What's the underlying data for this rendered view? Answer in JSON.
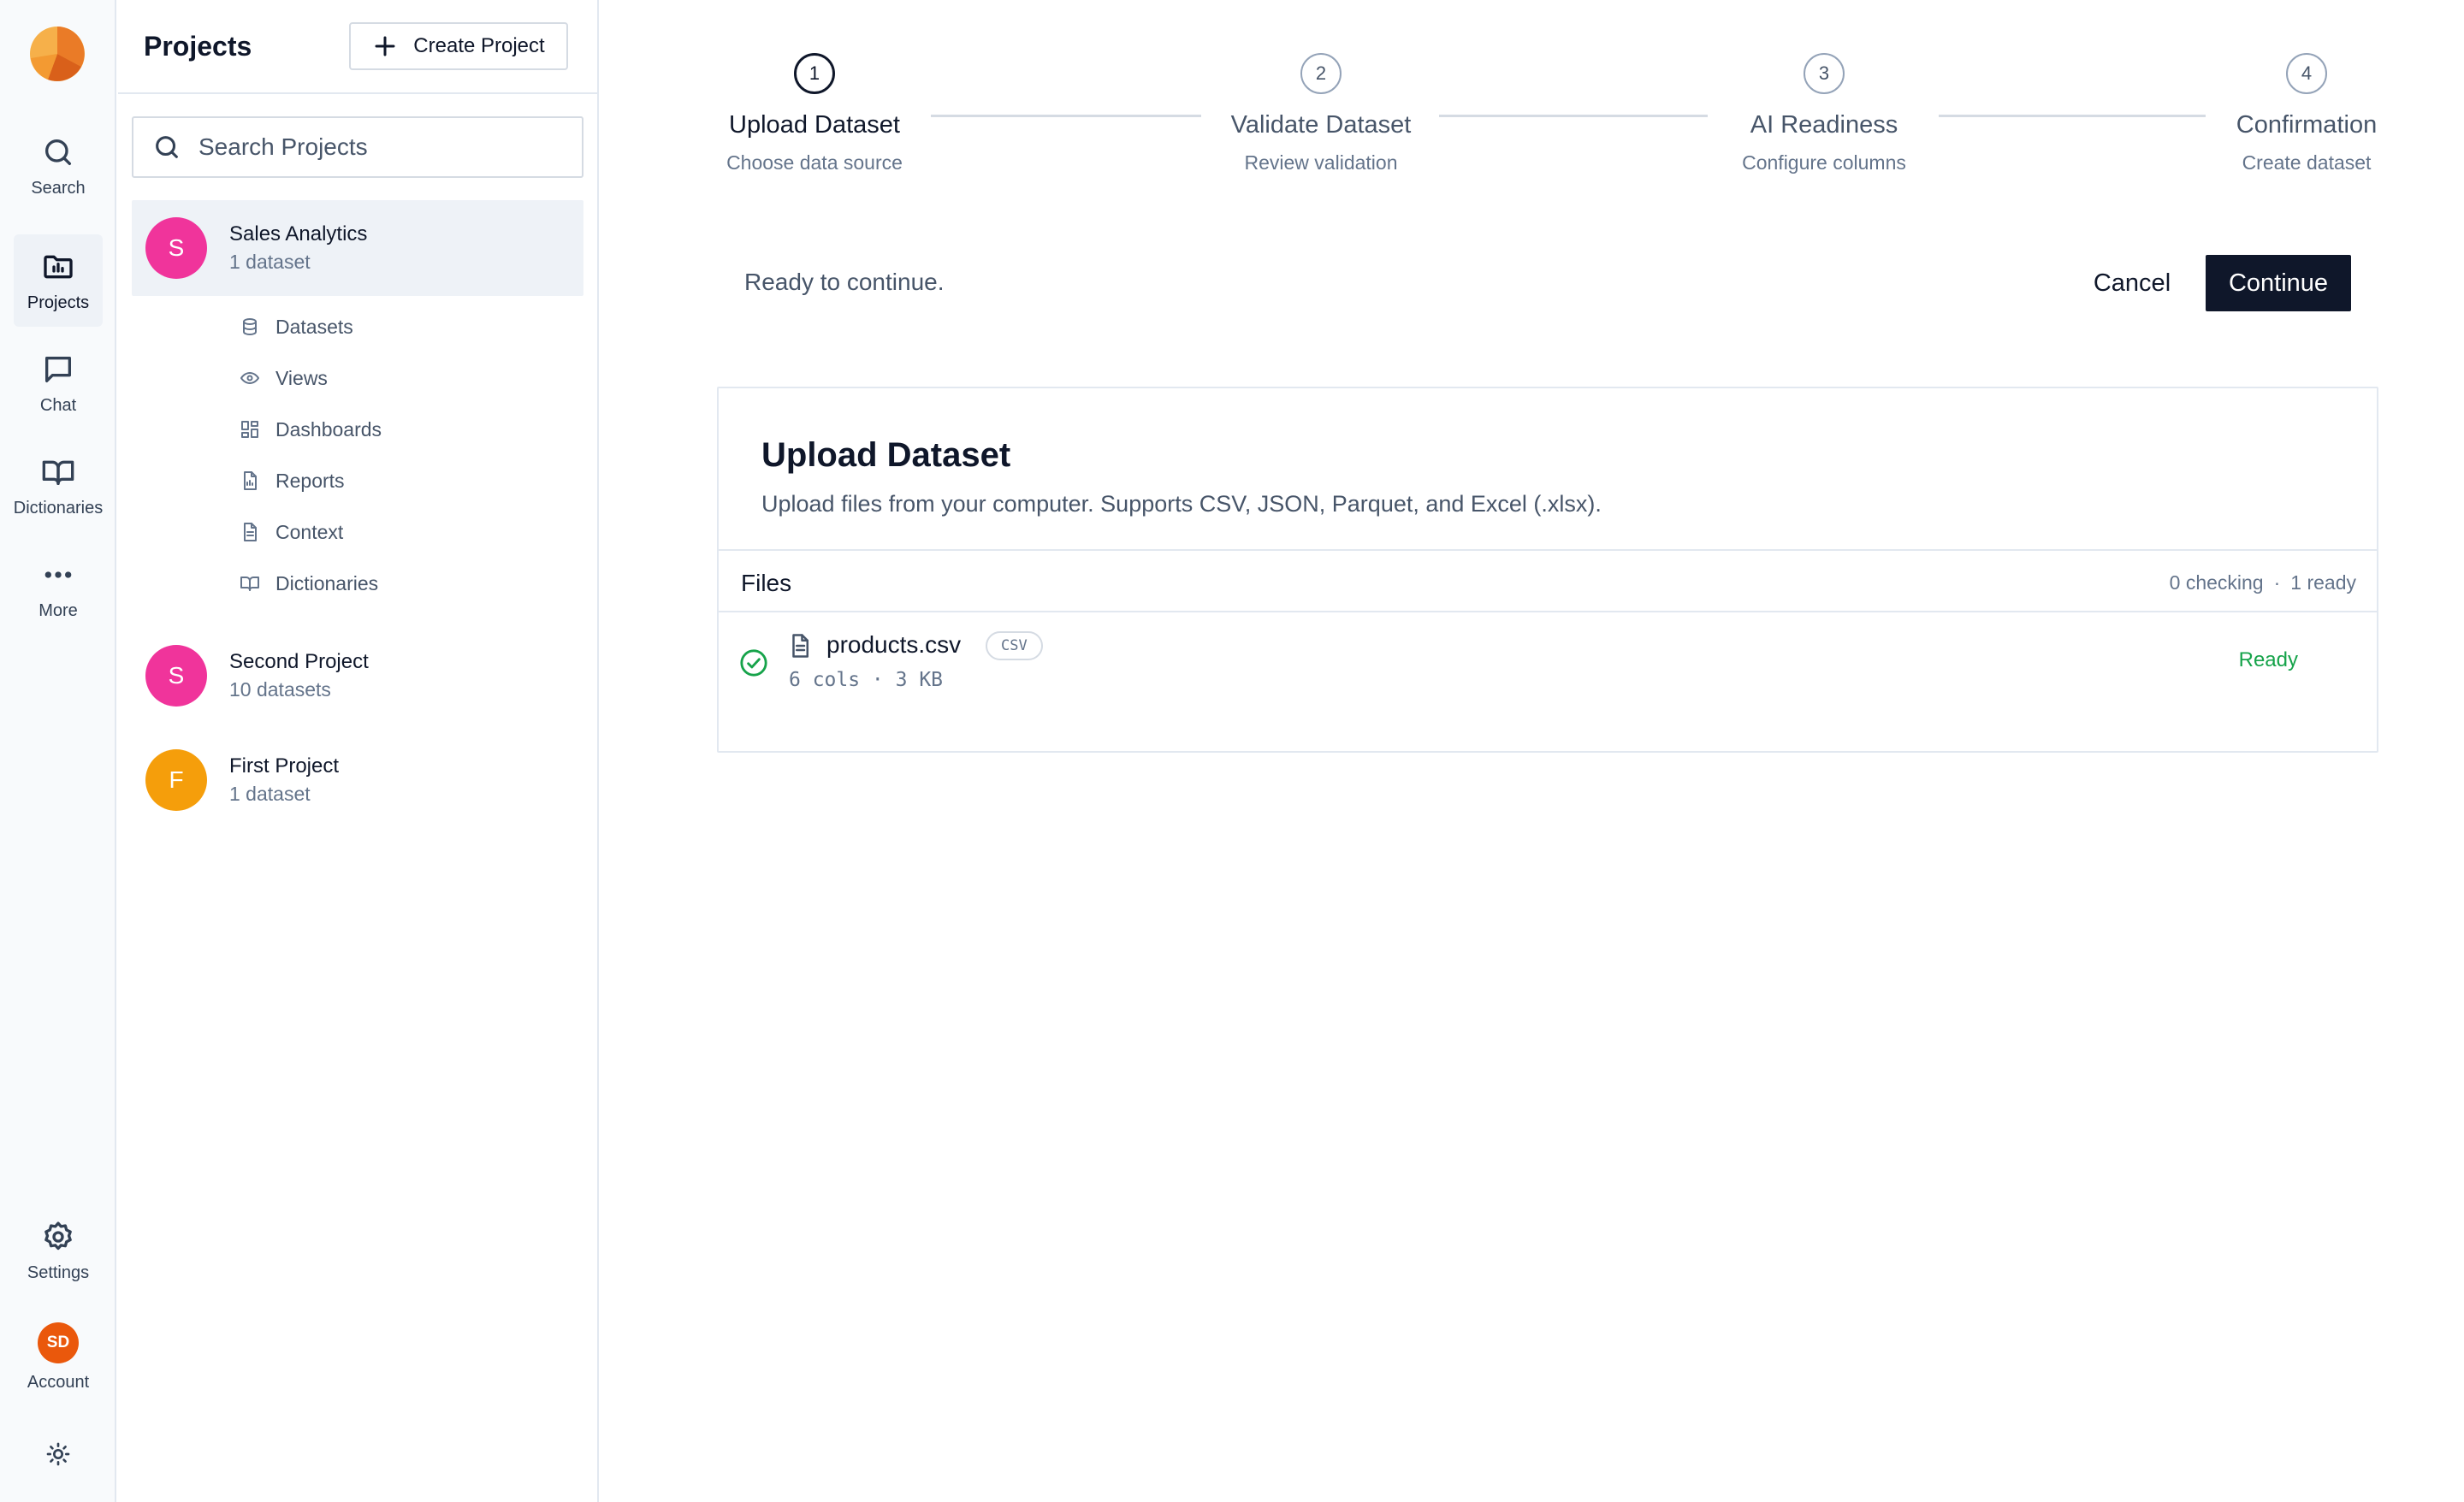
{
  "rail": {
    "items": [
      {
        "label": "Search",
        "icon": "search-icon"
      },
      {
        "label": "Projects",
        "icon": "folder-icon"
      },
      {
        "label": "Chat",
        "icon": "chat-icon"
      },
      {
        "label": "Dictionaries",
        "icon": "book-icon"
      },
      {
        "label": "More",
        "icon": "more-icon"
      }
    ],
    "settings_label": "Settings",
    "account_initials": "SD",
    "account_label": "Account",
    "colors": {
      "logo_primary": "#ea7b27",
      "logo_secondary": "#f6b04a",
      "account": "#ea580c"
    }
  },
  "panel": {
    "title": "Projects",
    "create_label": "Create Project",
    "search_placeholder": "Search Projects",
    "projects": [
      {
        "initial": "S",
        "name": "Sales Analytics",
        "count": "1 dataset",
        "color": "#f0349b"
      },
      {
        "initial": "S",
        "name": "Second Project",
        "count": "10 datasets",
        "color": "#f0349b"
      },
      {
        "initial": "F",
        "name": "First Project",
        "count": "1 dataset",
        "color": "#f59e0b"
      }
    ],
    "sub_items": [
      {
        "label": "Datasets",
        "icon": "database-icon"
      },
      {
        "label": "Views",
        "icon": "eye-icon"
      },
      {
        "label": "Dashboards",
        "icon": "dashboard-icon"
      },
      {
        "label": "Reports",
        "icon": "report-icon"
      },
      {
        "label": "Context",
        "icon": "document-icon"
      },
      {
        "label": "Dictionaries",
        "icon": "book-icon"
      }
    ]
  },
  "stepper": {
    "steps": [
      {
        "number": "1",
        "title": "Upload Dataset",
        "subtitle": "Choose data source"
      },
      {
        "number": "2",
        "title": "Validate Dataset",
        "subtitle": "Review validation"
      },
      {
        "number": "3",
        "title": "AI Readiness",
        "subtitle": "Configure columns"
      },
      {
        "number": "4",
        "title": "Confirmation",
        "subtitle": "Create dataset"
      }
    ],
    "active_step": 1
  },
  "actions": {
    "status": "Ready to continue.",
    "cancel_label": "Cancel",
    "continue_label": "Continue"
  },
  "upload": {
    "title": "Upload Dataset",
    "description": "Upload files from your computer. Supports CSV, JSON, Parquet, and Excel (.xlsx).",
    "files_label": "Files",
    "checking": "0 checking",
    "separator": "·",
    "ready_count": "1 ready",
    "files": [
      {
        "name": "products.csv",
        "type": "CSV",
        "meta": "6 cols · 3 KB",
        "status": "Ready",
        "status_color": "#16a34a"
      }
    ]
  }
}
